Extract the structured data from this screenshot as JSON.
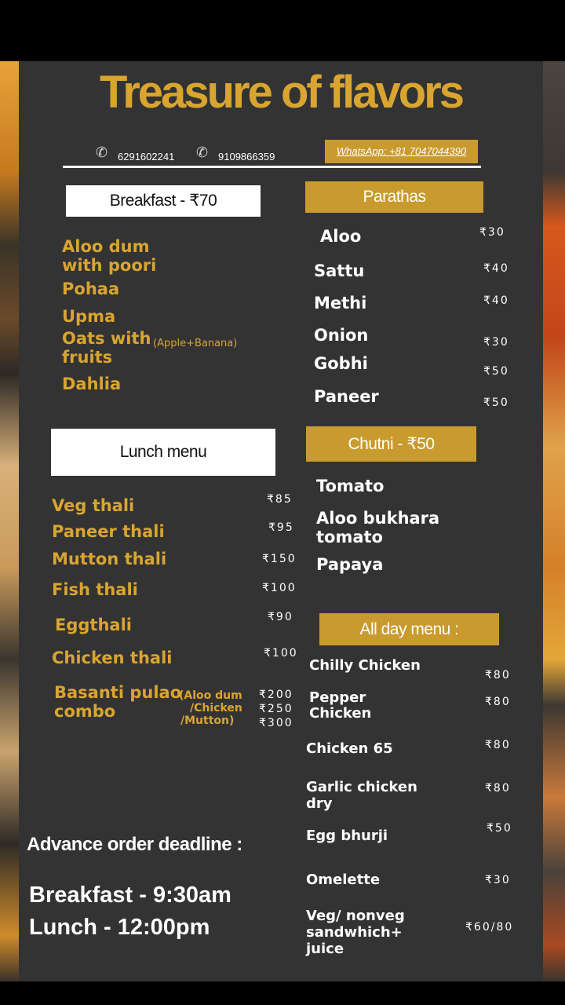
{
  "title": "Treasure of flavors",
  "contact": {
    "phone1": "6291602241",
    "phone2": "9109866359",
    "whatsapp": "WhatsApp: +81 7047044390",
    "phone_icon": "✆"
  },
  "breakfast": {
    "heading": "Breakfast - ₹70",
    "items": [
      "Aloo dum",
      "with poori",
      "Pohaa",
      "Upma",
      "Oats with",
      "fruits",
      "Dahlia"
    ],
    "oats_note": "(Apple+Banana)"
  },
  "lunch": {
    "heading": "Lunch menu",
    "items": [
      {
        "name": "Veg thali",
        "price": "₹85"
      },
      {
        "name": "Paneer thali",
        "price": "₹95"
      },
      {
        "name": "Mutton thali",
        "price": "₹150"
      },
      {
        "name": "Fish thali",
        "price": "₹100"
      },
      {
        "name": "Eggthali",
        "price": "₹90"
      },
      {
        "name": "Chicken thali",
        "price": "₹100"
      }
    ],
    "combo": {
      "name_line1": "Basanti pulao",
      "name_line2": "combo",
      "options": [
        "(Aloo dum",
        "/Chicken",
        "/Mutton)"
      ],
      "prices": [
        "₹200",
        "₹250",
        "₹300"
      ]
    }
  },
  "parathas": {
    "heading": "Parathas",
    "items": [
      {
        "name": "Aloo",
        "price": "₹30"
      },
      {
        "name": "Sattu",
        "price": "₹40"
      },
      {
        "name": "Methi",
        "price": "₹40"
      },
      {
        "name": "Onion",
        "price": "₹30"
      },
      {
        "name": "Gobhi",
        "price": "₹50"
      },
      {
        "name": "Paneer",
        "price": "₹50"
      }
    ]
  },
  "chutni": {
    "heading": "Chutni - ₹50",
    "items": [
      "Tomato",
      "Aloo bukhara",
      "tomato",
      "Papaya"
    ]
  },
  "all_day": {
    "heading": "All day menu :",
    "items": [
      {
        "name": "Chilly Chicken",
        "price": "₹80"
      },
      {
        "name": "Pepper",
        "name2": "Chicken",
        "price": "₹80"
      },
      {
        "name": "Chicken 65",
        "price": "₹80"
      },
      {
        "name": "Garlic chicken",
        "name2": "dry",
        "price": "₹80"
      },
      {
        "name": "Egg bhurji",
        "price": "₹50"
      },
      {
        "name": "Omelette",
        "price": "₹30"
      },
      {
        "name": "Veg/ nonveg",
        "name2": "sandwhich+",
        "name3": "juice",
        "price": "₹60/80"
      }
    ]
  },
  "deadline": {
    "heading": "Advance order deadline :",
    "breakfast": "Breakfast - 9:30am",
    "lunch": "Lunch - 12:00pm"
  },
  "colors": {
    "gold": "#d9a530",
    "gold_box": "#c99a2e",
    "panel": "#333333"
  }
}
